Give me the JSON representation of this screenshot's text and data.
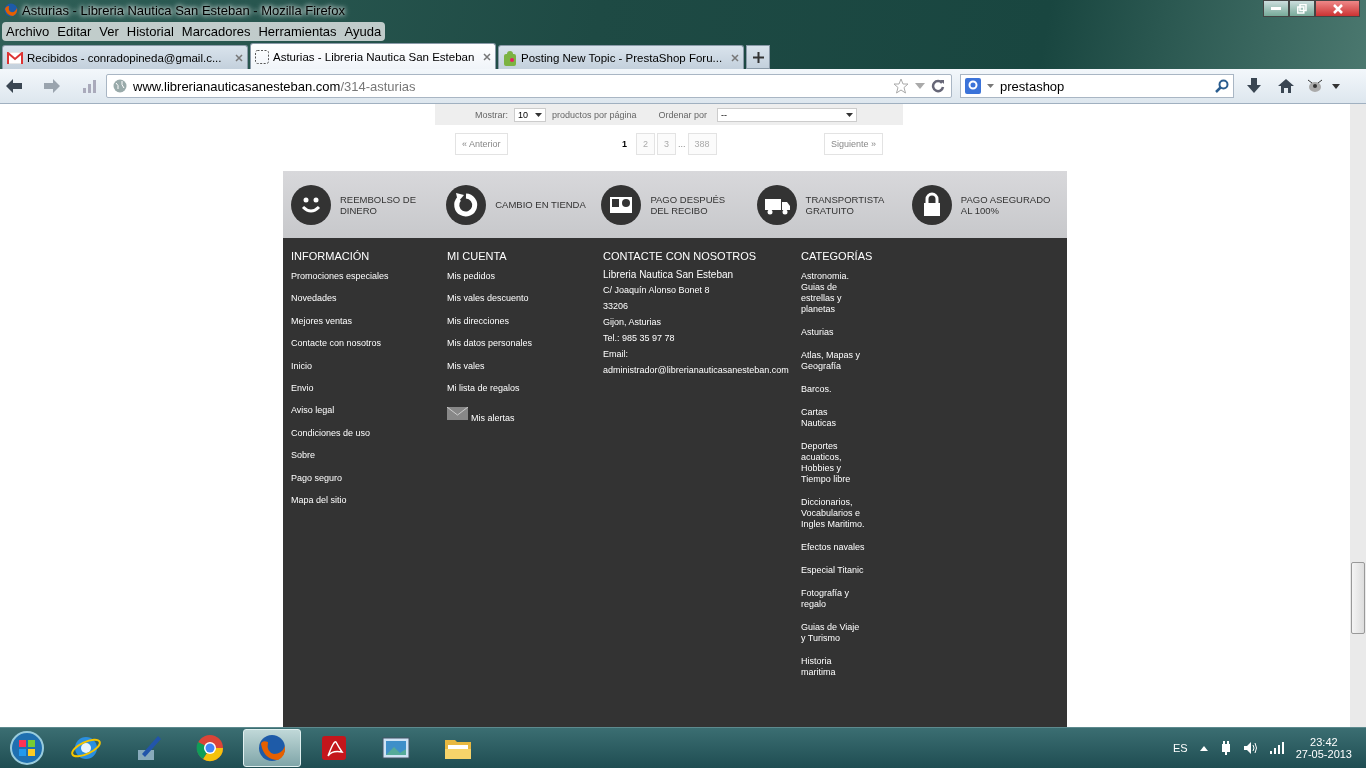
{
  "window": {
    "title": "Asturias - Libreria Nautica San Esteban - Mozilla Firefox"
  },
  "menu": [
    "Archivo",
    "Editar",
    "Ver",
    "Historial",
    "Marcadores",
    "Herramientas",
    "Ayuda"
  ],
  "tabs": [
    {
      "label": "Recibidos - conradopineda@gmail.c...",
      "selected": false,
      "kind": "mail"
    },
    {
      "label": "Asturias - Libreria Nautica San Esteban",
      "selected": true,
      "kind": "blank"
    },
    {
      "label": "Posting New Topic - PrestaShop Foru...",
      "selected": false,
      "kind": "forum"
    }
  ],
  "nav": {
    "url_host": "www.librerianauticasanesteban.com",
    "url_path": "/314-asturias",
    "search": "prestashop"
  },
  "listing": {
    "show_label": "Mostrar:",
    "show_value": "10",
    "per_page": "productos por página",
    "sort_label": "Ordenar por",
    "sort_value": "--"
  },
  "pagination": {
    "prev": "« Anterior",
    "next": "Siguiente »",
    "pages": [
      {
        "label": "1",
        "kind": "page",
        "selected": true
      },
      {
        "label": "2",
        "kind": "page",
        "selected": false
      },
      {
        "label": "3",
        "kind": "page",
        "selected": false
      },
      {
        "label": "...",
        "kind": "gap"
      },
      {
        "label": "388",
        "kind": "page",
        "selected": false
      }
    ]
  },
  "features": [
    {
      "kind": "smile",
      "label": "REEMBOLSO DE DINERO"
    },
    {
      "kind": "refresh",
      "label": "CAMBIO EN TIENDA"
    },
    {
      "kind": "card",
      "label": "PAGO DESPUÉS DEL RECIBO"
    },
    {
      "kind": "truck",
      "label": "TRANSPORTISTA GRATUITO"
    },
    {
      "kind": "lock",
      "label": "PAGO ASEGURADO AL 100%"
    }
  ],
  "footer": {
    "columns": [
      {
        "title": "INFORMACIÓN",
        "kind": "links",
        "items": [
          "Promociones especiales",
          "Novedades",
          "Mejores ventas",
          "Contacte con nosotros",
          "Inicio",
          "Envio",
          "Aviso legal",
          "Condiciones de uso",
          "Sobre",
          "Pago seguro",
          "Mapa del sitio"
        ]
      },
      {
        "title": "MI CUENTA",
        "kind": "links",
        "items": [
          "Mis pedidos",
          "Mis vales descuento",
          "Mis direcciones",
          "Mis datos personales",
          "Mis vales",
          "Mi lista de regalos"
        ],
        "alerts": "Mis alertas"
      },
      {
        "title": "CONTACTE CON NOSOTROS",
        "kind": "contact",
        "name": "Libreria Nautica San Esteban",
        "items": [
          "C/ Joaquín Alonso Bonet 8",
          "33206",
          "Gijon, Asturias",
          "Tel.: 985 35 97 78",
          "Email:",
          "administrador@librerianauticasanesteban.com"
        ]
      },
      {
        "title": "CATEGORÍAS",
        "kind": "categories",
        "items": [
          "Astronomia. Guias de estrellas y planetas",
          "Asturias",
          "Atlas, Mapas y Geografía",
          "Barcos.",
          "Cartas Nauticas",
          "Deportes acuaticos, Hobbies y Tiempo libre",
          "Diccionarios, Vocabularios e Ingles Maritimo.",
          "Efectos navales",
          "Especial Titanic",
          "Fotografía y regalo",
          "Guias de Viaje y Turismo",
          "Historia maritima"
        ]
      }
    ]
  },
  "taskbar": {
    "apps": [
      {
        "kind": "ie",
        "selected": false
      },
      {
        "kind": "tool",
        "selected": false
      },
      {
        "kind": "chrome",
        "selected": false
      },
      {
        "kind": "firefox",
        "selected": true
      },
      {
        "kind": "pdf",
        "selected": false
      },
      {
        "kind": "photo",
        "selected": false
      },
      {
        "kind": "folder",
        "selected": false
      }
    ],
    "language": "ES",
    "time": "23:42",
    "date": "27-05-2013"
  }
}
